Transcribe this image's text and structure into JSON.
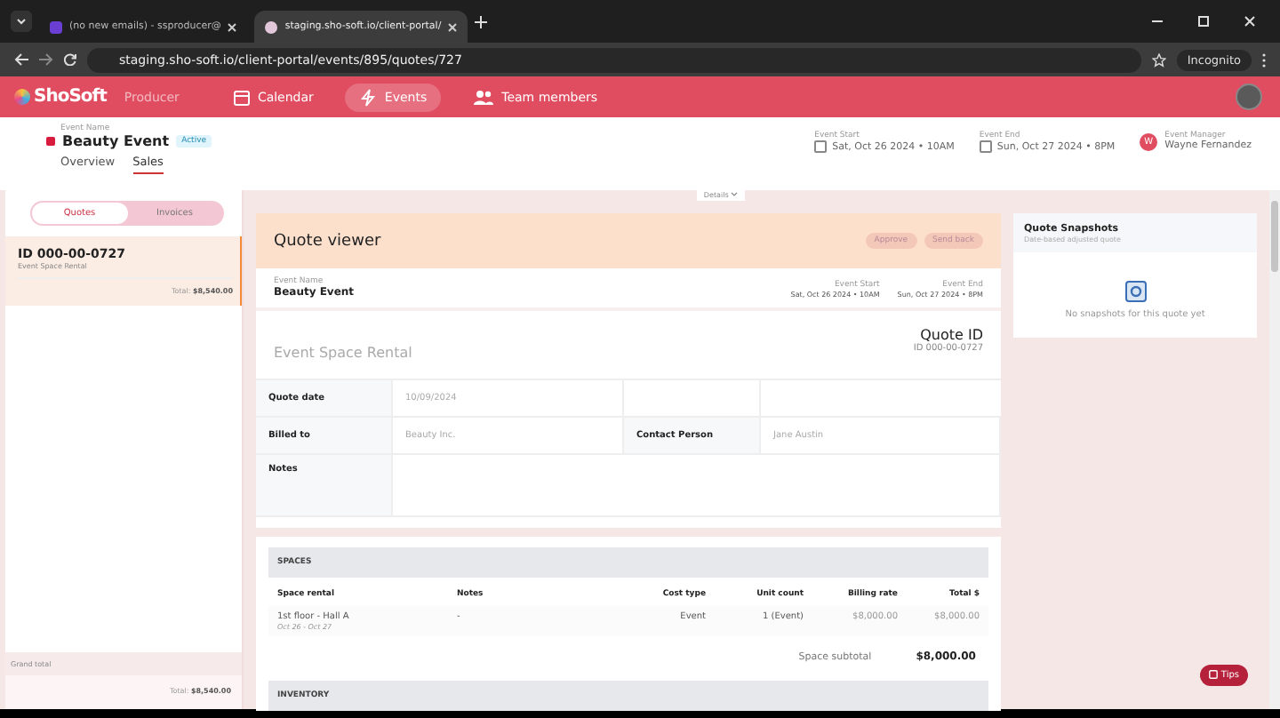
{
  "browser": {
    "tabs": [
      {
        "label": "(no new emails) - ssproducer@",
        "selected": false
      },
      {
        "label": "staging.sho-soft.io/client-portal/",
        "selected": true
      }
    ],
    "url": "staging.sho-soft.io/client-portal/events/895/quotes/727",
    "profile": "Incognito"
  },
  "app": {
    "brand": "ShoSoft",
    "role": "Producer",
    "nav": [
      {
        "label": "Calendar",
        "selected": false
      },
      {
        "label": "Events",
        "selected": true
      },
      {
        "label": "Team members",
        "selected": false
      }
    ]
  },
  "event": {
    "name_label": "Event Name",
    "name": "Beauty Event",
    "status": "Active",
    "color": "#d81b3c",
    "tabs": [
      {
        "label": "Overview",
        "selected": false
      },
      {
        "label": "Sales",
        "selected": true
      }
    ],
    "start_label": "Event Start",
    "start": "Sat, Oct 26 2024 • 10AM",
    "end_label": "Event End",
    "end": "Sun, Oct 27 2024 • 8PM",
    "manager_label": "Event Manager",
    "manager_initial": "W",
    "manager": "Wayne Fernandez"
  },
  "details_toggle": "Details",
  "sidebar": {
    "segments": [
      {
        "label": "Quotes",
        "selected": true
      },
      {
        "label": "Invoices",
        "selected": false
      }
    ],
    "quotes": [
      {
        "id": "ID 000-00-0727",
        "title": "Event Space Rental",
        "total_label": "Total:",
        "total": "$8,540.00",
        "selected": true
      }
    ],
    "grand_total_label": "Grand total",
    "grand_total_prefix": "Total:",
    "grand_total": "$8,540.00"
  },
  "viewer": {
    "title": "Quote viewer",
    "actions": [
      "Approve",
      "Send back"
    ],
    "event_name_label": "Event Name",
    "event_name": "Beauty Event",
    "start_label": "Event Start",
    "start": "Sat, Oct 26 2024 • 10AM",
    "end_label": "Event End",
    "end": "Sun, Oct 27 2024 • 8PM",
    "quote_title": "Event Space Rental",
    "quote_id_label": "Quote ID",
    "quote_id": "ID 000-00-0727",
    "fields": [
      {
        "label": "Quote date",
        "value": "10/09/2024"
      },
      {
        "label": "Billed to",
        "value": "Beauty Inc.",
        "label2": "Contact Person",
        "value2": "Jane Austin"
      },
      {
        "label": "Notes"
      }
    ],
    "spaces": {
      "heading": "SPACES",
      "columns": [
        "Space rental",
        "Notes",
        "Cost type",
        "Unit count",
        "Billing rate",
        "Total $"
      ],
      "rows": [
        {
          "name": "1st floor - Hall A",
          "dates": "Oct 26 - Oct 27",
          "notes": "-",
          "cost_type": "Event",
          "unit_count": "1 (Event)",
          "billing_rate": "$8,000.00",
          "total": "$8,000.00"
        }
      ],
      "subtotal_label": "Space subtotal",
      "subtotal": "$8,000.00"
    },
    "inventory_heading": "INVENTORY"
  },
  "snapshots": {
    "title": "Quote Snapshots",
    "subtitle": "Date-based adjusted quote",
    "empty": "No snapshots for this quote yet"
  },
  "tips": "Tips"
}
